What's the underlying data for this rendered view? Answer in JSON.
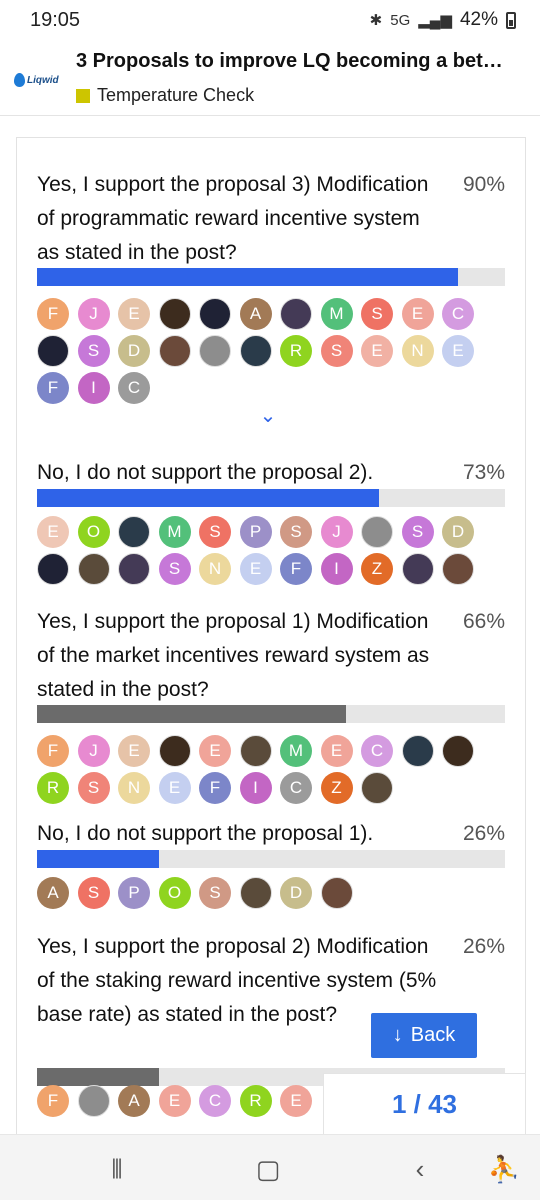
{
  "status_bar": {
    "time": "19:05",
    "bluetooth_icon": "bluetooth-icon",
    "network": "5G",
    "battery": "42%"
  },
  "header": {
    "logo_text": "Liqwid",
    "title": "3 Proposals to improve LQ becoming a bet…",
    "category": "Temperature Check",
    "category_color": "#cdc500"
  },
  "poll": {
    "options": [
      {
        "text": "Yes, I support the proposal 3) Modification of programmatic reward incentive system as stated in the post?",
        "percent": "90%",
        "value": 90,
        "fill": "blue"
      },
      {
        "text": "No, I do not support the proposal 2).",
        "percent": "73%",
        "value": 73,
        "fill": "blue"
      },
      {
        "text": "Yes, I support the proposal 1) Modification of the market incentives reward system as stated in the post?",
        "percent": "66%",
        "value": 66,
        "fill": "grey"
      },
      {
        "text": "No, I do not support the proposal 1).",
        "percent": "26%",
        "value": 26,
        "fill": "blue"
      },
      {
        "text": "Yes, I support the proposal 2) Modification of the staking reward incentive system (5% base rate) as stated in the post?",
        "percent": "26%",
        "value": 26,
        "fill": "grey"
      }
    ],
    "voters": [
      [
        [
          "F",
          "#f0a36b"
        ],
        [
          "J",
          "#e78ad0"
        ],
        [
          "E",
          "#e6c3a8"
        ],
        [
          "",
          "pic"
        ],
        [
          "",
          "pic"
        ],
        [
          "A",
          "#a27a56"
        ],
        [
          "",
          "pic"
        ],
        [
          "M",
          "#53c07a"
        ],
        [
          "S",
          "#ef7264"
        ],
        [
          "E",
          "#f0a499"
        ],
        [
          "C",
          "#d49be0"
        ],
        [
          "",
          "pic"
        ],
        [
          "S",
          "#c678d8"
        ],
        [
          "D",
          "#c7bd8c"
        ],
        [
          "",
          "pic"
        ],
        [
          "",
          "pic"
        ],
        [
          "",
          "pic"
        ],
        [
          "R",
          "#8fd41f"
        ],
        [
          "S",
          "#f08478"
        ],
        [
          "E",
          "#f1b1a4"
        ],
        [
          "N",
          "#ecd89c"
        ],
        [
          "E",
          "#c4cff0"
        ],
        [
          "F",
          "#7c86c9"
        ],
        [
          "I",
          "#c366c4"
        ],
        [
          "C",
          "#9b9b9b"
        ]
      ],
      [
        [
          "E",
          "#efc7b5"
        ],
        [
          "O",
          "#8fd41f"
        ],
        [
          "",
          "pic"
        ],
        [
          "M",
          "#53c07a"
        ],
        [
          "S",
          "#ef7264"
        ],
        [
          "P",
          "#9c90c8"
        ],
        [
          "S",
          "#d09985"
        ],
        [
          "J",
          "#e78ad0"
        ],
        [
          "",
          "pic"
        ],
        [
          "S",
          "#c678d8"
        ],
        [
          "D",
          "#c7bd8c"
        ],
        [
          "",
          "pic"
        ],
        [
          "",
          "pic"
        ],
        [
          "",
          "pic"
        ],
        [
          "S",
          "#c678d8"
        ],
        [
          "N",
          "#ecd89c"
        ],
        [
          "E",
          "#c4cff0"
        ],
        [
          "F",
          "#7c86c9"
        ],
        [
          "I",
          "#c366c4"
        ],
        [
          "Z",
          "#e26b28"
        ],
        [
          "",
          "pic"
        ],
        [
          "",
          "pic"
        ]
      ],
      [
        [
          "F",
          "#f0a36b"
        ],
        [
          "J",
          "#e78ad0"
        ],
        [
          "E",
          "#e6c3a8"
        ],
        [
          "",
          "pic"
        ],
        [
          "E",
          "#f0a499"
        ],
        [
          "",
          "pic"
        ],
        [
          "M",
          "#53c07a"
        ],
        [
          "E",
          "#f0a499"
        ],
        [
          "C",
          "#d49be0"
        ],
        [
          "",
          "pic"
        ],
        [
          "",
          "pic"
        ],
        [
          "R",
          "#8fd41f"
        ],
        [
          "S",
          "#f08478"
        ],
        [
          "N",
          "#ecd89c"
        ],
        [
          "E",
          "#c4cff0"
        ],
        [
          "F",
          "#7c86c9"
        ],
        [
          "I",
          "#c366c4"
        ],
        [
          "C",
          "#9b9b9b"
        ],
        [
          "Z",
          "#e26b28"
        ],
        [
          "",
          "pic"
        ]
      ],
      [
        [
          "A",
          "#a27a56"
        ],
        [
          "S",
          "#ef7264"
        ],
        [
          "P",
          "#9c90c8"
        ],
        [
          "O",
          "#8fd41f"
        ],
        [
          "S",
          "#d09985"
        ],
        [
          "",
          "pic"
        ],
        [
          "D",
          "#c7bd8c"
        ],
        [
          "",
          "pic"
        ]
      ],
      [
        [
          "F",
          "#f0a36b"
        ],
        [
          "",
          "pic"
        ],
        [
          "A",
          "#a27a56"
        ],
        [
          "E",
          "#f0a499"
        ],
        [
          "C",
          "#d49be0"
        ],
        [
          "R",
          "#8fd41f"
        ],
        [
          "E",
          "#f0a499"
        ]
      ]
    ]
  },
  "back_button": {
    "label": "Back"
  },
  "progress": {
    "current": "1",
    "total": "43",
    "text": "1 / 43"
  },
  "nav": {
    "recents": "|||",
    "home": "○",
    "back": "<",
    "accessibility": "accessibility-icon"
  }
}
